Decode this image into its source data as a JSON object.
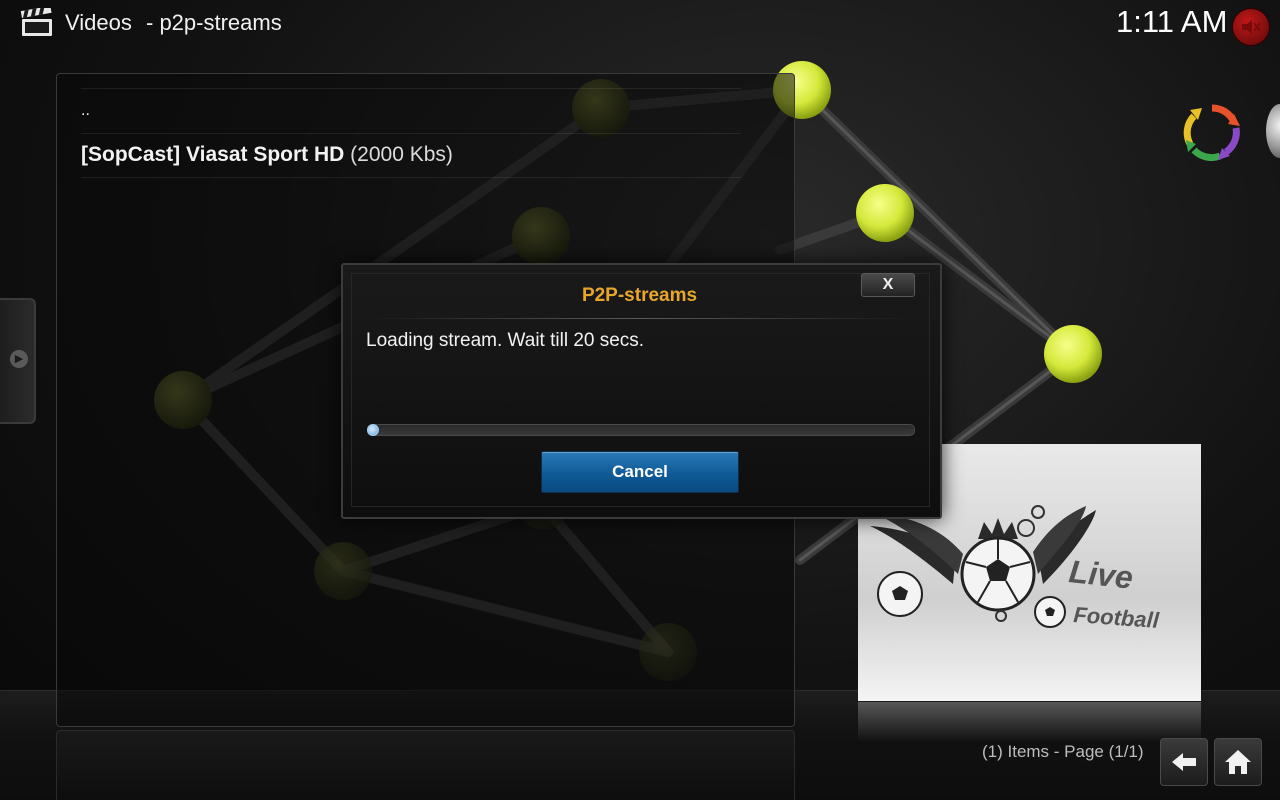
{
  "header": {
    "section": "Videos",
    "path": "- p2p-streams",
    "clock": "1:11 AM",
    "icons": {
      "section_icon": "clapperboard-icon",
      "mute_icon": "speaker-muted-icon"
    }
  },
  "list": {
    "parent_label": "..",
    "items": [
      {
        "name": "[SopCast] Viasat Sport HD",
        "bitrate": "(2000 Kbs)"
      }
    ]
  },
  "thumbnail": {
    "text_line1": "Live",
    "text_line2": "Football"
  },
  "dialog": {
    "title": "P2P-streams",
    "message": "Loading stream. Wait till 20 secs.",
    "close_label": "X",
    "progress_percent": 0,
    "cancel_label": "Cancel"
  },
  "footer": {
    "items_info": "(1) Items - Page (1/1)",
    "back_icon": "back-arrow-icon",
    "home_icon": "home-icon"
  },
  "colors": {
    "dialog_title": "#e8a62a",
    "button_blue": "#0f5a96",
    "node_green": "#d4e83a"
  }
}
